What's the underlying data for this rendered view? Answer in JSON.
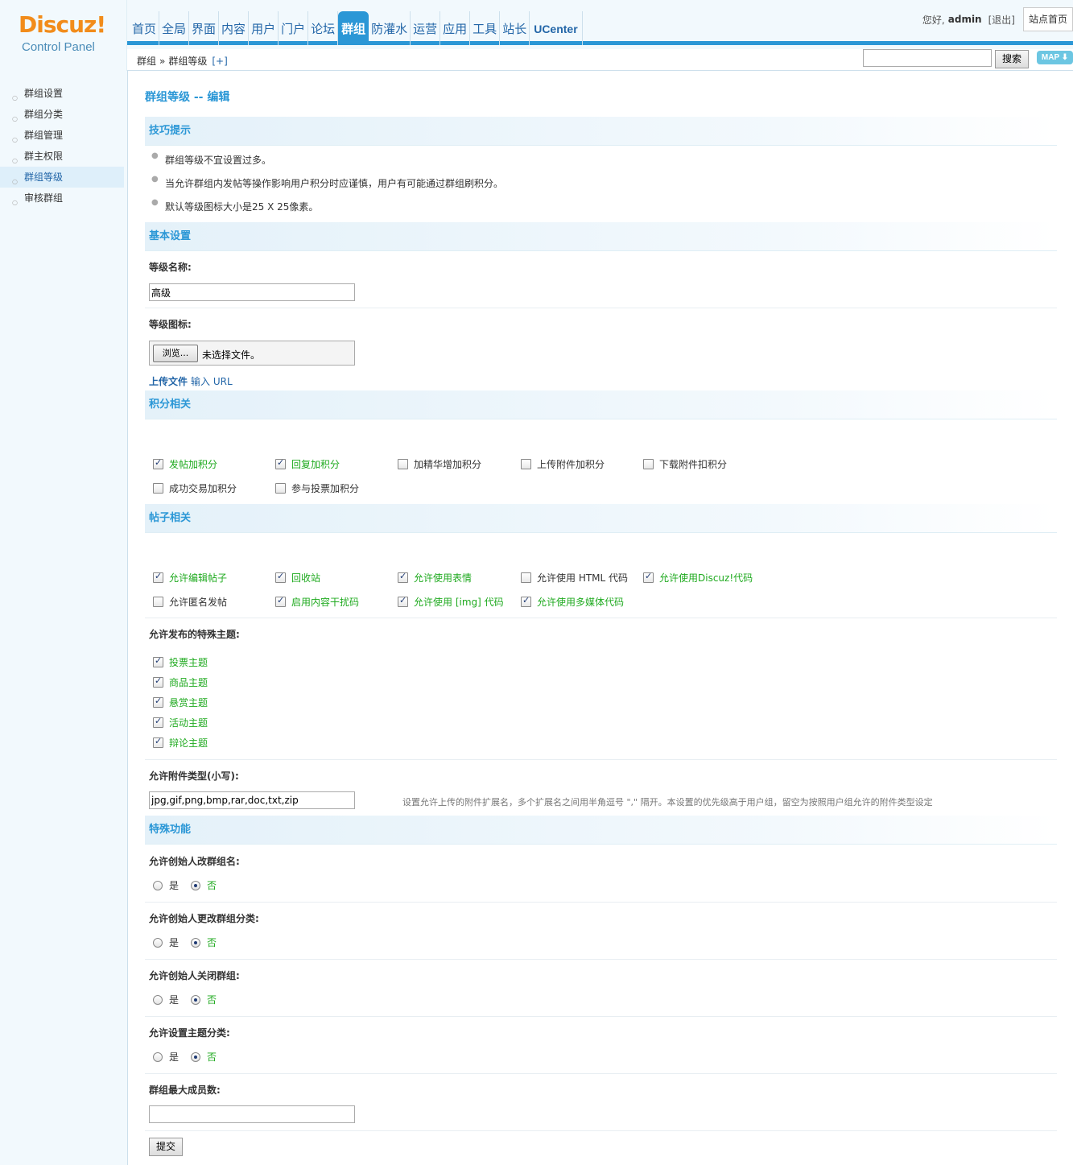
{
  "logo": {
    "brand": "Discuz!",
    "sub": "Control Panel"
  },
  "nav": {
    "items": [
      "首页",
      "全局",
      "界面",
      "内容",
      "用户",
      "门户",
      "论坛",
      "群组",
      "防灌水",
      "运营",
      "应用",
      "工具",
      "站长",
      "UCenter"
    ],
    "active": "群组"
  },
  "userbar": {
    "greeting": "您好,",
    "username": "admin",
    "logout": "[退出]",
    "site_home": "站点首页"
  },
  "breadcrumb": {
    "root": "群组",
    "sep": "»",
    "current": "群组等级",
    "add": "[+]"
  },
  "search": {
    "value": "",
    "button": "搜索",
    "map": "MAP ⬇"
  },
  "sidebar": {
    "items": [
      "群组设置",
      "群组分类",
      "群组管理",
      "群主权限",
      "群组等级",
      "审核群组"
    ],
    "active": "群组等级"
  },
  "page": {
    "title": "群组等级 -- 编辑"
  },
  "tips": {
    "heading": "技巧提示",
    "items": [
      "群组等级不宜设置过多。",
      "当允许群组内发帖等操作影响用户积分时应谨慎，用户有可能通过群组刷积分。",
      "默认等级图标大小是25 X 25像素。"
    ]
  },
  "basic": {
    "heading": "基本设置",
    "level_name_label": "等级名称:",
    "level_name_value": "高级",
    "level_icon_label": "等级图标:",
    "file_button": "浏览...",
    "file_text": "未选择文件。",
    "upload_file": "上传文件",
    "input_url": "输入 URL"
  },
  "credits": {
    "heading": "积分相关",
    "options": [
      {
        "label": "发帖加积分",
        "checked": true
      },
      {
        "label": "回复加积分",
        "checked": true
      },
      {
        "label": "加精华增加积分",
        "checked": false
      },
      {
        "label": "上传附件加积分",
        "checked": false
      },
      {
        "label": "下载附件扣积分",
        "checked": false
      },
      {
        "label": "成功交易加积分",
        "checked": false
      },
      {
        "label": "参与投票加积分",
        "checked": false
      }
    ]
  },
  "posts": {
    "heading": "帖子相关",
    "options": [
      {
        "label": "允许编辑帖子",
        "checked": true
      },
      {
        "label": "回收站",
        "checked": true
      },
      {
        "label": "允许使用表情",
        "checked": true
      },
      {
        "label": "允许使用 HTML 代码",
        "checked": false
      },
      {
        "label": "允许使用Discuz!代码",
        "checked": true
      },
      {
        "label": "允许匿名发帖",
        "checked": false
      },
      {
        "label": "启用内容干扰码",
        "checked": true
      },
      {
        "label": "允许使用 [img] 代码",
        "checked": true
      },
      {
        "label": "允许使用多媒体代码",
        "checked": true
      }
    ],
    "special_label": "允许发布的特殊主题:",
    "special": [
      {
        "label": "投票主题",
        "checked": true
      },
      {
        "label": "商品主题",
        "checked": true
      },
      {
        "label": "悬赏主题",
        "checked": true
      },
      {
        "label": "活动主题",
        "checked": true
      },
      {
        "label": "辩论主题",
        "checked": true
      }
    ],
    "attach_label": "允许附件类型(小写):",
    "attach_value": "jpg,gif,png,bmp,rar,doc,txt,zip",
    "attach_hint": "设置允许上传的附件扩展名，多个扩展名之间用半角逗号 \",\" 隔开。本设置的优先级高于用户组，留空为按照用户组允许的附件类型设定"
  },
  "special": {
    "heading": "特殊功能",
    "questions": [
      {
        "label": "允许创始人改群组名:",
        "yes": "是",
        "no": "否",
        "value": "no"
      },
      {
        "label": "允许创始人更改群组分类:",
        "yes": "是",
        "no": "否",
        "value": "no"
      },
      {
        "label": "允许创始人关闭群组:",
        "yes": "是",
        "no": "否",
        "value": "no"
      },
      {
        "label": "允许设置主题分类:",
        "yes": "是",
        "no": "否",
        "value": "no"
      }
    ],
    "max_members_label": "群组最大成员数:",
    "max_members_value": "",
    "submit": "提交"
  }
}
